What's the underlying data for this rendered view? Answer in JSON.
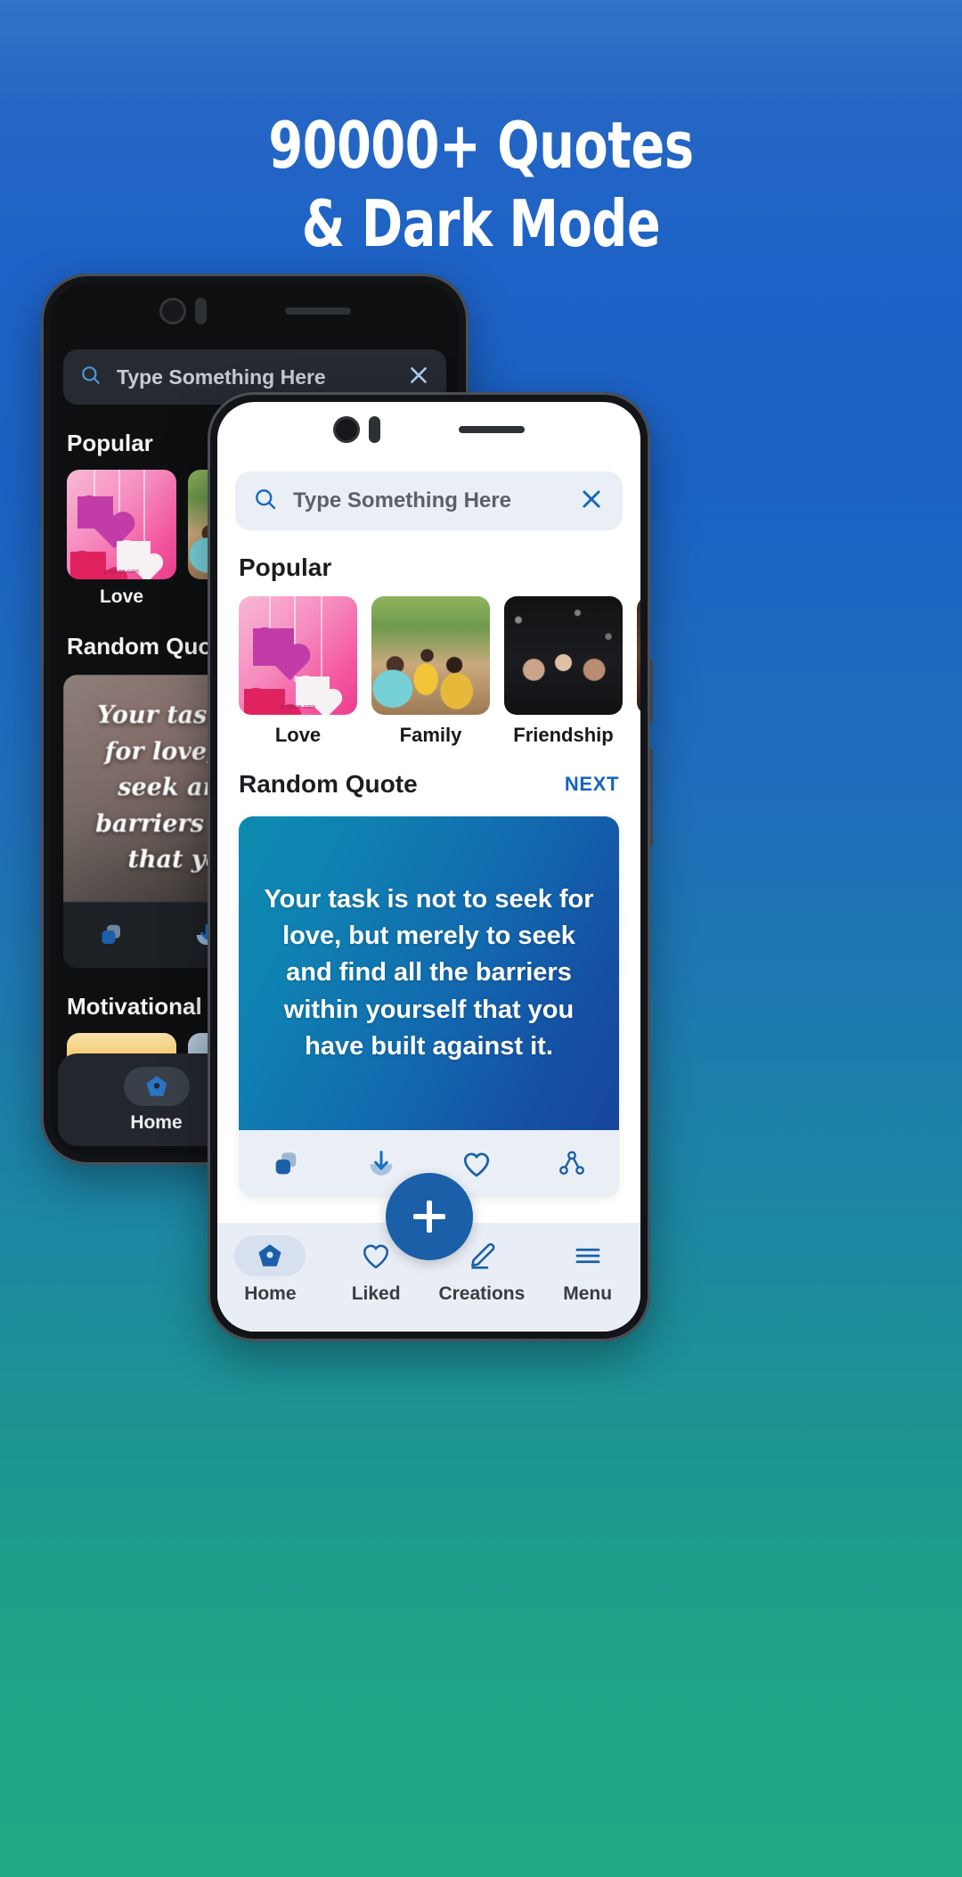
{
  "headline": {
    "line1": "90000+ Quotes",
    "line2": "& Dark Mode"
  },
  "colors": {
    "bg_top": "#2f74c9",
    "bg_mid": "#1b62c4",
    "bg_bottom": "#21a884",
    "accent_blue": "#1565c0",
    "fab_blue": "#1a5fa8",
    "quote_gradient_start": "#0d8ab0",
    "quote_gradient_end": "#17469d",
    "dark_bg": "#0e0f11",
    "dark_field": "#262a31",
    "light_field": "#eaeef5",
    "nav_light": "#e9eef6"
  },
  "front_phone": {
    "search": {
      "placeholder": "Type Something Here",
      "search_icon": "search-icon",
      "clear_icon": "close-icon"
    },
    "popular": {
      "title": "Popular",
      "items": [
        {
          "label": "Love",
          "art": "art-love"
        },
        {
          "label": "Family",
          "art": "art-family"
        },
        {
          "label": "Friendship",
          "art": "art-friend"
        },
        {
          "label": "",
          "art": "art-people"
        }
      ]
    },
    "random_quote": {
      "title": "Random Quote",
      "next_label": "NEXT",
      "quote_text": "Your task is not to seek for love, but merely to seek and find all the barriers within yourself that you have built against it.",
      "actions": [
        {
          "name": "copy-icon"
        },
        {
          "name": "download-icon"
        },
        {
          "name": "heart-icon"
        },
        {
          "name": "share-icon"
        }
      ]
    },
    "motivational": {
      "title": "Motivational",
      "items": [
        {
          "art": "art-sunset"
        },
        {
          "art": "art-sky"
        },
        {
          "art": "art-sand"
        },
        {
          "art": "art-blue"
        }
      ]
    },
    "nav": {
      "fab_label": "+",
      "items": [
        {
          "label": "Home",
          "icon": "home-icon",
          "active": true
        },
        {
          "label": "Liked",
          "icon": "heart-icon",
          "active": false
        },
        {
          "label": "Creations",
          "icon": "pencil-icon",
          "active": false
        },
        {
          "label": "Menu",
          "icon": "hamburger-icon",
          "active": false
        }
      ]
    }
  },
  "back_phone": {
    "search": {
      "placeholder": "Type Something Here",
      "search_icon": "search-icon",
      "clear_icon": "close-icon"
    },
    "popular": {
      "title": "Popular",
      "items": [
        {
          "label": "Love",
          "art": "art-love"
        },
        {
          "label": "",
          "art": "art-family"
        }
      ]
    },
    "random_quote": {
      "title": "Random Quote",
      "quote_text": "Your task is not to seek for love, but merely to seek and find all the barriers within yourself that you have built"
    },
    "motivational": {
      "title": "Motivational",
      "items": [
        {
          "art": "art-sunset"
        },
        {
          "art": "art-sky"
        }
      ]
    },
    "nav": {
      "items": [
        {
          "label": "Home",
          "icon": "home-icon",
          "active": true
        },
        {
          "label": "Liked",
          "icon": "heart-icon",
          "active": false
        }
      ]
    }
  }
}
